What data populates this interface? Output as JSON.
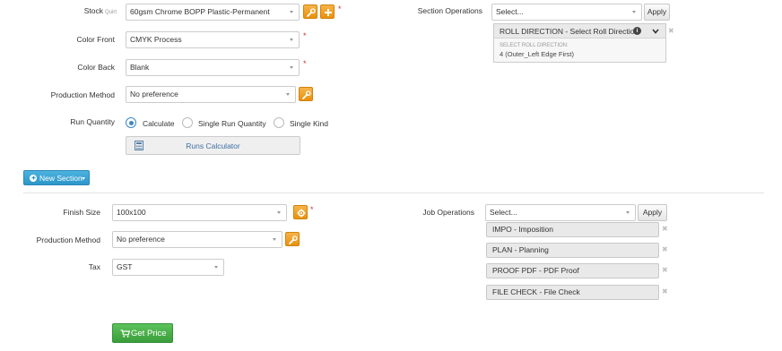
{
  "section": {
    "stock": {
      "label": "Stock",
      "sublabel": "Quirt",
      "value": "60gsm Chrome BOPP Plastic-Permanent"
    },
    "color_front": {
      "label": "Color Front",
      "value": "CMYK Process"
    },
    "color_back": {
      "label": "Color Back",
      "value": "Blank"
    },
    "production_method": {
      "label": "Production Method",
      "value": "No preference"
    },
    "run_quantity": {
      "label": "Run Quantity",
      "options": [
        "Calculate",
        "Single Run Quantity",
        "Single Kind"
      ],
      "selected": "Calculate"
    },
    "runs_calculator_label": "Runs Calculator",
    "required_mark": "*",
    "operations": {
      "label": "Section Operations",
      "select_value": "Select...",
      "apply_label": "Apply",
      "roll_direction": {
        "title": "ROLL DIRECTION - Select Roll Direction",
        "detail_heading": "SELECT ROLL DIRECTION:",
        "detail_value": "4 (Outer_Left Edge First)"
      }
    }
  },
  "new_section_label": "New Section",
  "job": {
    "finish_size": {
      "label": "Finish Size",
      "value": "100x100"
    },
    "production_method": {
      "label": "Production Method",
      "value": "No preference"
    },
    "tax": {
      "label": "Tax",
      "value": "GST"
    },
    "operations": {
      "label": "Job Operations",
      "select_value": "Select...",
      "apply_label": "Apply",
      "items": [
        "IMPO - Imposition",
        "PLAN - Planning",
        "PROOF PDF - PDF Proof",
        "FILE CHECK - File Check"
      ]
    }
  },
  "get_price_label": "Get Price",
  "colors": {
    "accent_orange": "#f0a030",
    "accent_blue": "#3aa6d6",
    "accent_green": "#45b045",
    "radio_blue": "#3b87c8"
  }
}
